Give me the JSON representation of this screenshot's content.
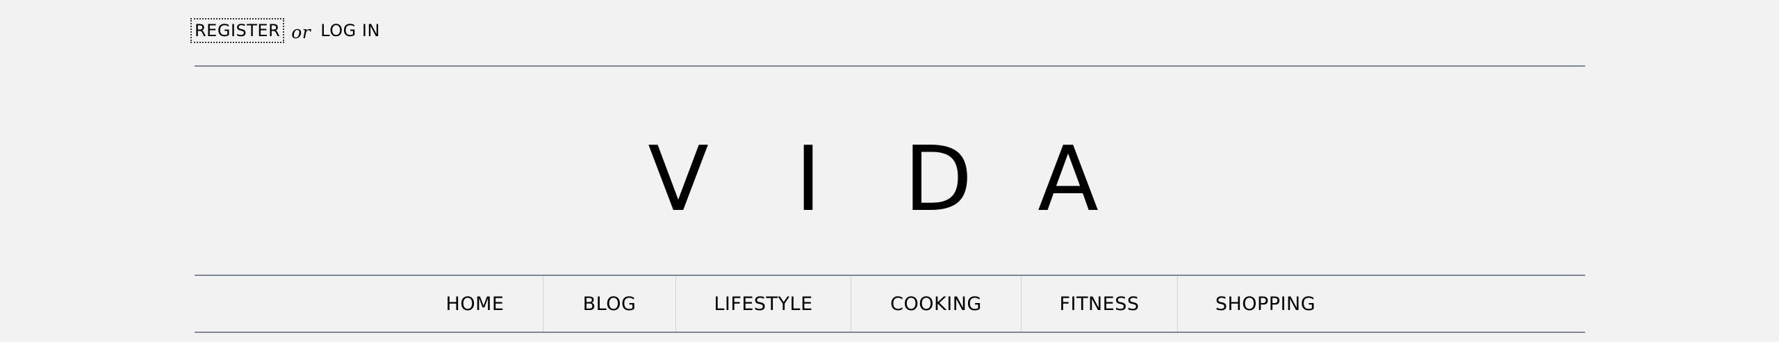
{
  "auth": {
    "register_label": "REGISTER",
    "or_label": "or",
    "login_label": "LOG IN"
  },
  "logo": {
    "letters": [
      "V",
      "I",
      "D",
      "A"
    ]
  },
  "nav": {
    "items": [
      {
        "label": "HOME"
      },
      {
        "label": "BLOG"
      },
      {
        "label": "LIFESTYLE"
      },
      {
        "label": "COOKING"
      },
      {
        "label": "FITNESS"
      },
      {
        "label": "SHOPPING"
      }
    ]
  },
  "colors": {
    "background": "#f3f2f3",
    "rule": "#7f8796",
    "divider": "#cfd2d7",
    "text": "#000000"
  }
}
